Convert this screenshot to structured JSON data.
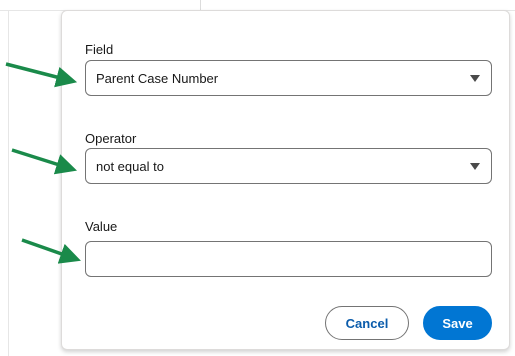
{
  "filter_popover": {
    "field": {
      "label": "Field",
      "value": "Parent Case Number"
    },
    "operator": {
      "label": "Operator",
      "value": "not equal to"
    },
    "value": {
      "label": "Value",
      "value": ""
    },
    "buttons": {
      "cancel": "Cancel",
      "save": "Save"
    }
  },
  "colors": {
    "arrow": "#1a8a4a",
    "primary": "#0176d3",
    "cancel_text": "#0b5cab",
    "border": "#747474"
  },
  "icons": {
    "dropdown": "chevron-down-icon",
    "annotation": "arrow-icon"
  }
}
